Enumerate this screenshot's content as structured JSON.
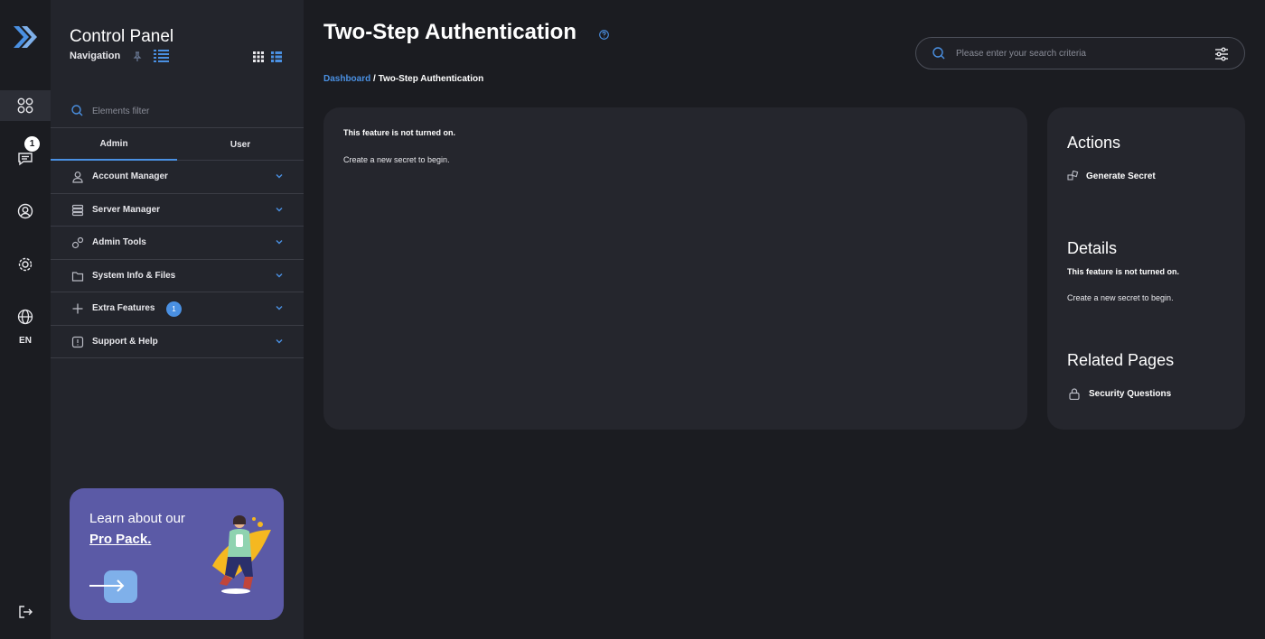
{
  "rail": {
    "notifications_count": "1",
    "language": "EN"
  },
  "sidebar": {
    "title": "Control Panel",
    "navigation_label": "Navigation",
    "filter_placeholder": "Elements filter",
    "tabs": [
      {
        "label": "Admin",
        "active": true
      },
      {
        "label": "User",
        "active": false
      }
    ],
    "items": [
      {
        "label": "Account Manager",
        "icon": "user-icon"
      },
      {
        "label": "Server Manager",
        "icon": "server-icon"
      },
      {
        "label": "Admin Tools",
        "icon": "gears-icon"
      },
      {
        "label": "System Info & Files",
        "icon": "folder-icon"
      },
      {
        "label": "Extra Features",
        "icon": "plus-icon",
        "badge": "1"
      },
      {
        "label": "Support & Help",
        "icon": "alert-icon"
      }
    ]
  },
  "promo": {
    "line1": "Learn about our",
    "line2": "Pro Pack."
  },
  "header": {
    "title": "Two-Step Authentication",
    "search_placeholder": "Please enter your search criteria"
  },
  "breadcrumb": {
    "home": "Dashboard",
    "separator": " / ",
    "current": "Two-Step Authentication"
  },
  "main_card": {
    "heading": "This feature is not turned on.",
    "text": "Create a new secret to begin."
  },
  "side_card": {
    "actions_title": "Actions",
    "generate_secret": "Generate Secret",
    "details_title": "Details",
    "details_heading": "This feature is not turned on.",
    "details_text": "Create a new secret to begin.",
    "related_title": "Related Pages",
    "security_questions": "Security Questions"
  },
  "colors": {
    "accent": "#4a90e2",
    "background": "#1b1c21",
    "sidebar": "#23252c",
    "card": "#25262d",
    "promo": "#5b5aa6"
  }
}
